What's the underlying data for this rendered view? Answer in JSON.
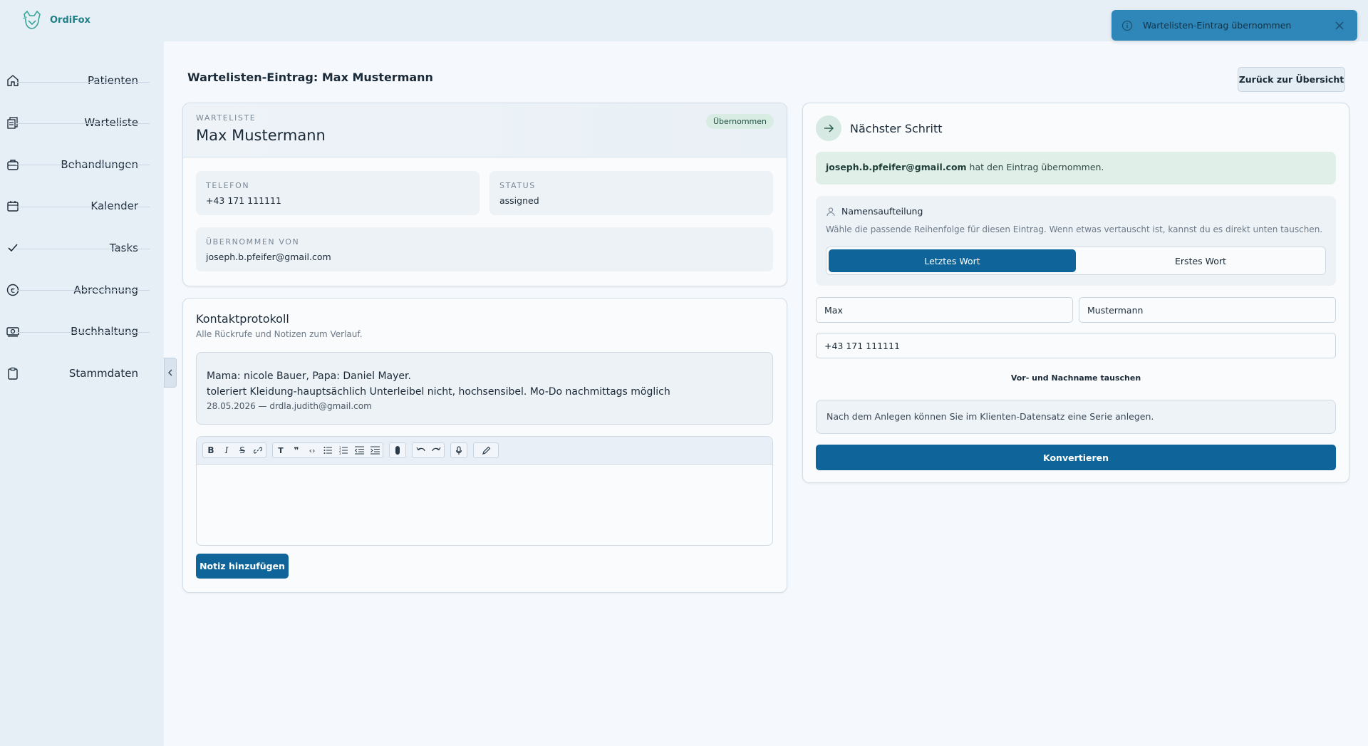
{
  "app": {
    "name": "OrdiFox"
  },
  "sidebar": {
    "items": [
      {
        "label": "Patienten",
        "icon": "home-icon"
      },
      {
        "label": "Warteliste",
        "icon": "clipboard-list-icon"
      },
      {
        "label": "Behandlungen",
        "icon": "briefcase-icon"
      },
      {
        "label": "Kalender",
        "icon": "calendar-icon"
      },
      {
        "label": "Tasks",
        "icon": "check-icon"
      },
      {
        "label": "Abrechnung",
        "icon": "euro-icon"
      },
      {
        "label": "Buchhaltung",
        "icon": "banknote-icon"
      },
      {
        "label": "Stammdaten",
        "icon": "clipboard-icon"
      }
    ]
  },
  "toast": {
    "message": "Wartelisten-Eintrag übernommen"
  },
  "page": {
    "title": "Wartelisten-Eintrag: Max Mustermann",
    "back_button": "Zurück zur Übersicht"
  },
  "entry": {
    "eyebrow": "WARTELISTE",
    "name": "Max Mustermann",
    "badge": "Übernommen",
    "phone_label": "TELEFON",
    "phone": "+43 171 111111",
    "status_label": "STATUS",
    "status": "assigned",
    "taken_by_label": "ÜBERNOMMEN VON",
    "taken_by": "joseph.b.pfeifer@gmail.com"
  },
  "contact_log": {
    "title": "Kontaktprotokoll",
    "subtitle": "Alle Rückrufe und Notizen zum Verlauf.",
    "note": {
      "line1": "Mama: nicole Bauer, Papa: Daniel Mayer.",
      "line2": "toleriert Kleidung-hauptsächlich Unterleibel nicht, hochsensibel. Mo-Do nachmittags möglich",
      "meta": "28.05.2026 — drdla.judith@gmail.com"
    },
    "add_note_button": "Notiz hinzufügen"
  },
  "next_step": {
    "title": "Nächster Schritt",
    "assigned_email": "joseph.b.pfeifer@gmail.com",
    "assigned_text": "hat den Eintrag übernommen.",
    "split_title": "Namensaufteilung",
    "split_desc": "Wähle die passende Reihenfolge für diesen Eintrag. Wenn etwas vertauscht ist, kannst du es direkt unten tauschen.",
    "option_last": "Letztes Wort",
    "option_first": "Erstes Wort",
    "first_name": "Max",
    "last_name": "Mustermann",
    "phone": "+43 171 111111",
    "swap_button": "Vor- und Nachname tauschen",
    "hint": "Nach dem Anlegen können Sie im Klienten-Datensatz eine Serie anlegen.",
    "convert_button": "Konvertieren"
  },
  "colors": {
    "primary": "#0f6499",
    "toast": "#2e87b8",
    "badge_bg": "#d8ece4",
    "sidebar_bg": "#e6eef6"
  }
}
